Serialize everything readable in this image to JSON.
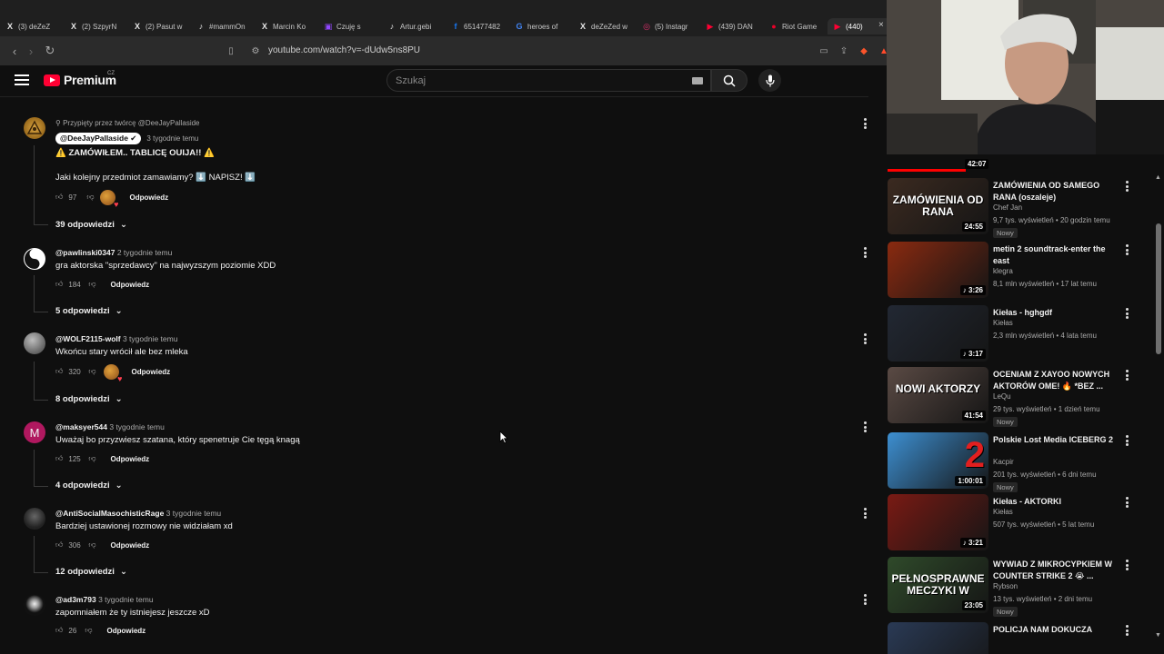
{
  "browser": {
    "tabs": [
      {
        "label": "(3) deZeZ",
        "icon": "x"
      },
      {
        "label": "(2) SzpyrN",
        "icon": "x"
      },
      {
        "label": "(2) Pasut w",
        "icon": "x"
      },
      {
        "label": "#mammOn",
        "icon": "tiktok"
      },
      {
        "label": "Marcin Ko",
        "icon": "x"
      },
      {
        "label": "Czuję s",
        "icon": "twitch"
      },
      {
        "label": "Artur.gebi",
        "icon": "tiktok"
      },
      {
        "label": "651477482",
        "icon": "facebook"
      },
      {
        "label": "heroes of",
        "icon": "google"
      },
      {
        "label": "deZeZed w",
        "icon": "x"
      },
      {
        "label": "(5) Instagr",
        "icon": "instagram"
      },
      {
        "label": "(439) DAN",
        "icon": "youtube"
      },
      {
        "label": "Riot Game",
        "icon": "riot"
      },
      {
        "label": "(440)",
        "icon": "youtube"
      }
    ],
    "url": "youtube.com/watch?v=-dUdw5ns8PU"
  },
  "header": {
    "logo": "Premium",
    "country": "CZ",
    "search_placeholder": "Szukaj"
  },
  "comments": [
    {
      "pinned": "Przypięty przez twórcę @DeeJayPallaside",
      "author": "@DeeJayPallaside",
      "time": "3 tygodnie temu",
      "text1": "⚠️ ZAMÓWIŁEM.. TABLICĘ OUIJA!! ⚠️",
      "text2": "Jaki kolejny przedmiot zamawiamy? ⬇️ NAPISZ! ⬇️",
      "likes": "97",
      "reply": "Odpowiedz",
      "replies": "39 odpowiedzi"
    },
    {
      "author": "@pawlinski0347",
      "time": "2 tygodnie temu",
      "text": "gra aktorska \"sprzedawcy\" na najwyzszym poziomie XDD",
      "likes": "184",
      "reply": "Odpowiedz",
      "replies": "5 odpowiedzi"
    },
    {
      "author": "@WOLF2115-wolf",
      "time": "3 tygodnie temu",
      "text": "Wkońcu stary wrócił ale bez mleka",
      "likes": "320",
      "reply": "Odpowiedz",
      "replies": "8 odpowiedzi"
    },
    {
      "author": "@maksyer544",
      "time": "3 tygodnie temu",
      "text": "Uważaj bo przyzwiesz szatana, który spenetruje Cie tęgą knagą",
      "likes": "125",
      "reply": "Odpowiedz",
      "replies": "4 odpowiedzi",
      "avatar_letter": "M"
    },
    {
      "author": "@AntiSocialMasochisticRage",
      "time": "3 tygodnie temu",
      "text": "Bardziej ustawionej rozmowy nie widziałam xd",
      "likes": "306",
      "reply": "Odpowiedz",
      "replies": "12 odpowiedzi"
    },
    {
      "author": "@ad3m793",
      "time": "3 tygodnie temu",
      "text": "zapomniałem że ty istniejesz jeszcze xD",
      "likes": "26",
      "reply": "Odpowiedz"
    }
  ],
  "sidebar": {
    "webcam_time": "42:07",
    "videos": [
      {
        "title": "ZAMÓWIENIA OD SAMEGO RANA (oszaleje)",
        "channel": "Chef Jan",
        "stats": "9,7 tys. wyświetleń • 20 godzin temu",
        "badge": "Nowy",
        "duration": "24:55",
        "thumb_text": "ZAMÓWIENIA OD RANA",
        "color": "#3b2a20"
      },
      {
        "title": "metin 2 soundtrack-enter the east",
        "channel": "klegra",
        "stats": "8,1 mln wyświetleń • 17 lat temu",
        "badge": "",
        "duration": "♪ 3:26",
        "thumb_text": "",
        "color": "#8a2a10"
      },
      {
        "title": "Kiełas - hghgdf",
        "channel": "Kiełas",
        "stats": "2,3 mln wyświetleń • 4 lata temu",
        "badge": "",
        "duration": "♪ 3:17",
        "thumb_text": "",
        "color": "#222833"
      },
      {
        "title": "OCENIAM Z XAYOO NOWYCH AKTORÓW OME! 🔥 *BEZ ...",
        "channel": "LeQu",
        "stats": "29 tys. wyświetleń • 1 dzień temu",
        "badge": "Nowy",
        "duration": "41:54",
        "thumb_text": "NOWI AKTORZY",
        "color": "#5a4a44"
      },
      {
        "title": "Polskie Lost Media ICEBERG 2",
        "channel": "Kacpir",
        "stats": "201 tys. wyświetleń • 6 dni temu",
        "badge": "Nowy",
        "duration": "1:00:01",
        "thumb_text": "2",
        "color": "#3d8fd1"
      },
      {
        "title": "Kiełas - AKTORKI",
        "channel": "Kiełas",
        "stats": "507 tys. wyświetleń • 5 lat temu",
        "badge": "",
        "duration": "♪ 3:21",
        "thumb_text": "",
        "color": "#7a1a14"
      },
      {
        "title": "WYWIAD Z MIKROCYPKIEM W COUNTER STRIKE 2 😭 ...",
        "channel": "Rybson",
        "stats": "13 tys. wyświetleń • 2 dni temu",
        "badge": "Nowy",
        "duration": "23:05",
        "thumb_text": "PEŁNOSPRAWNE MECZYKI W",
        "color": "#2f4a2a"
      },
      {
        "title": "POLICJA NAM DOKUCZA",
        "channel": "",
        "stats": "",
        "badge": "",
        "duration": "",
        "thumb_text": "",
        "color": "#2a3a55"
      }
    ]
  }
}
